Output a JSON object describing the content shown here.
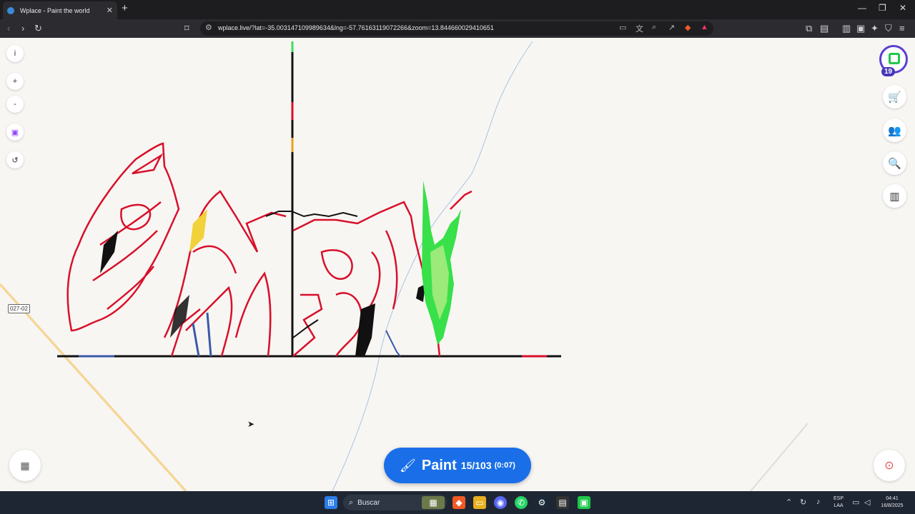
{
  "browser": {
    "tab_title": "Wplace - Paint the world",
    "tab_close": "✕",
    "new_tab": "+",
    "url": "wplace.live/?lat=-35.003147109989634&lng=-57.76163119072266&zoom=13.844660029410651",
    "window_controls": [
      "—",
      "❐",
      "✕"
    ]
  },
  "left_toolbar": {
    "info": "i",
    "zoom_in": "+",
    "zoom_out": "-",
    "twitch": "▣",
    "undo": "↺"
  },
  "right_toolbar": {
    "level": "19",
    "store_icon": "cart-icon",
    "alliance_icon": "group-icon",
    "search_icon": "search-globe-icon",
    "leaderboard_icon": "leaderboard-icon"
  },
  "map": {
    "road_label": "027-02"
  },
  "paint_button": {
    "label": "Paint",
    "charges": "15/103",
    "timer": "(0:07)"
  },
  "taskbar": {
    "search_placeholder": "Buscar",
    "lang_top": "ESP",
    "lang_bottom": "LAA",
    "time": "04:41",
    "date": "16/8/2025"
  },
  "colors": {
    "paint_blue": "#1a6fe8",
    "art_red": "#d8102a",
    "art_green": "#38e04a",
    "avatar_ring": "#5b3fd0"
  }
}
